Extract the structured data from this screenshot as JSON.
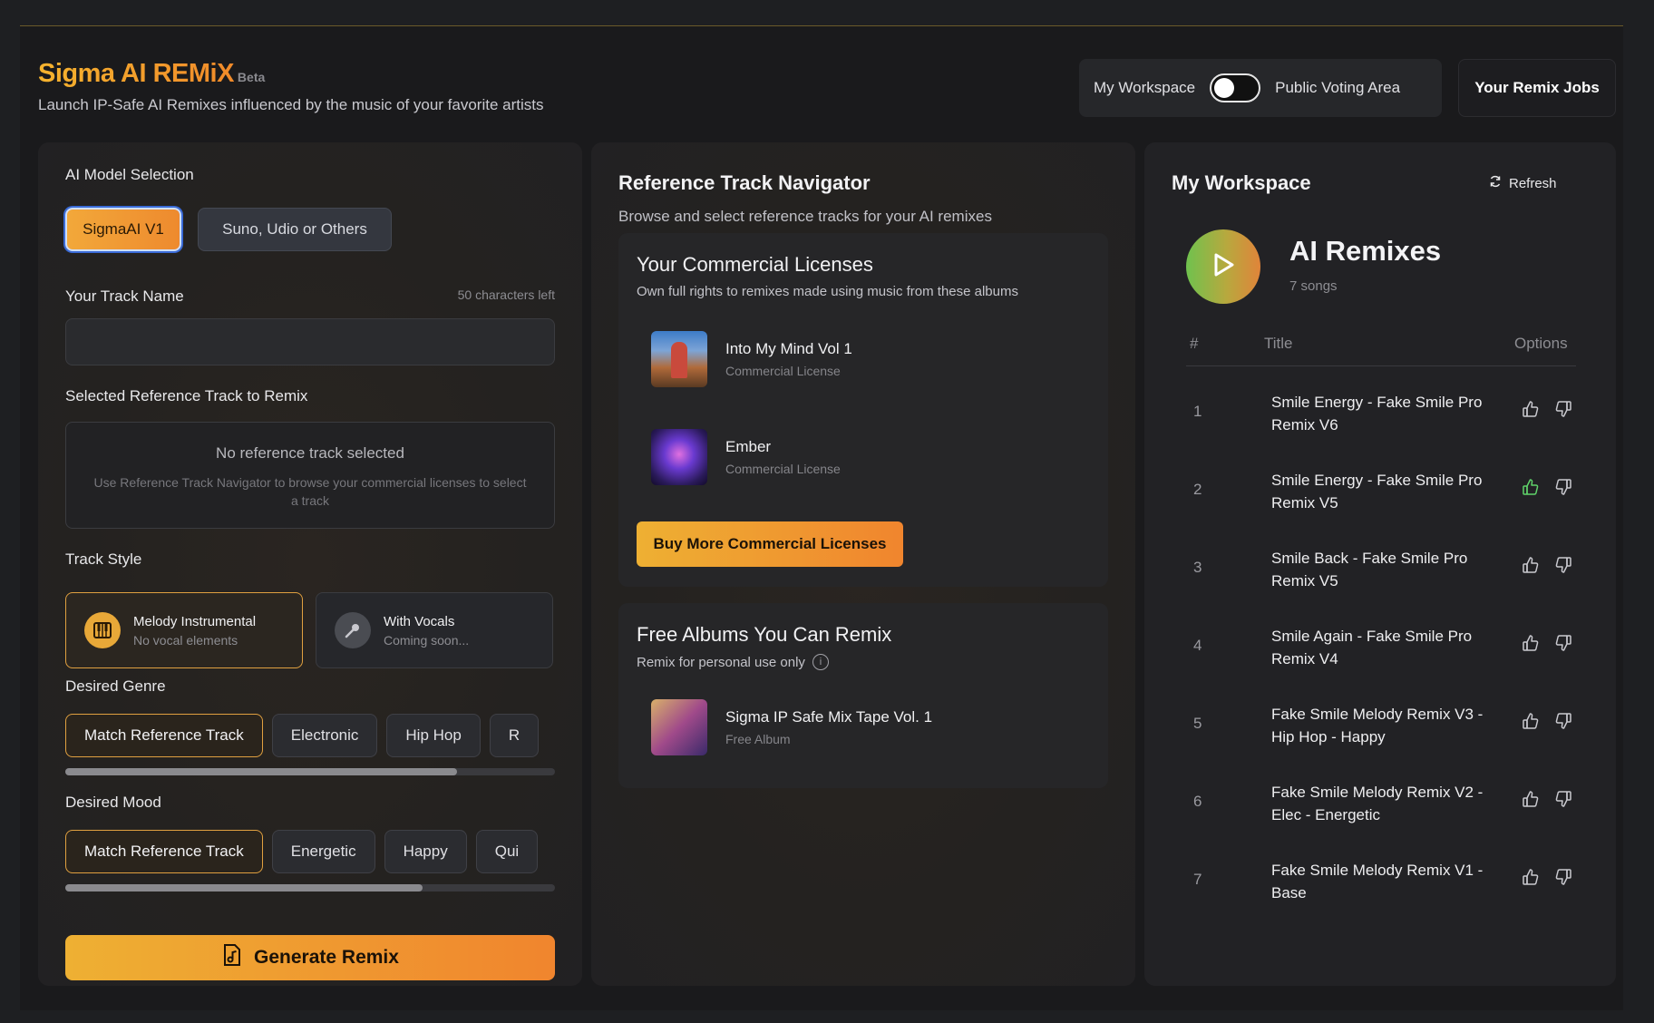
{
  "header": {
    "title": "Sigma AI REMiX",
    "beta": "Beta",
    "subtitle": "Launch IP-Safe AI Remixes influenced by the music of your favorite artists",
    "toggle_left": "My Workspace",
    "toggle_right": "Public Voting Area",
    "jobs_button": "Your Remix Jobs"
  },
  "left_panel": {
    "model_label": "AI Model Selection",
    "models": [
      "SigmaAI V1",
      "Suno, Udio or Others"
    ],
    "track_name_label": "Your Track Name",
    "chars_left": "50 characters left",
    "track_name_value": "",
    "ref_label": "Selected Reference Track to Remix",
    "ref_empty_title": "No reference track selected",
    "ref_empty_desc": "Use Reference Track Navigator to browse your commercial licenses to select a track",
    "style_label": "Track Style",
    "styles": [
      {
        "name": "Melody Instrumental",
        "desc": "No vocal elements",
        "icon": "piano-icon"
      },
      {
        "name": "With Vocals",
        "desc": "Coming soon...",
        "icon": "microphone-icon"
      }
    ],
    "genre_label": "Desired Genre",
    "genres": [
      "Match Reference Track",
      "Electronic",
      "Hip Hop",
      "R"
    ],
    "genre_scroll_fraction": 0.8,
    "mood_label": "Desired Mood",
    "moods": [
      "Match Reference Track",
      "Energetic",
      "Happy",
      "Qui"
    ],
    "mood_scroll_fraction": 0.73,
    "generate_button": "Generate Remix"
  },
  "navigator": {
    "title": "Reference Track Navigator",
    "subtitle": "Browse and select reference tracks for your AI remixes",
    "commercial": {
      "title": "Your Commercial Licenses",
      "desc": "Own full rights to remixes made using music from these albums",
      "albums": [
        {
          "name": "Into My Mind Vol 1",
          "license": "Commercial License"
        },
        {
          "name": "Ember",
          "license": "Commercial License"
        }
      ],
      "buy_button": "Buy More Commercial Licenses"
    },
    "free": {
      "title": "Free Albums You Can Remix",
      "desc": "Remix for personal use only",
      "albums": [
        {
          "name": "Sigma IP Safe Mix Tape Vol. 1",
          "license": "Free Album"
        }
      ]
    }
  },
  "workspace": {
    "title": "My Workspace",
    "refresh": "Refresh",
    "playlist_title": "AI Remixes",
    "playlist_count": "7 songs",
    "col_num": "#",
    "col_title": "Title",
    "col_options": "Options",
    "tracks": [
      {
        "num": "1",
        "title": "Smile Energy - Fake Smile Pro Remix V6",
        "liked": false
      },
      {
        "num": "2",
        "title": "Smile Energy - Fake Smile Pro Remix V5",
        "liked": true
      },
      {
        "num": "3",
        "title": "Smile Back - Fake Smile Pro Remix V5",
        "liked": false
      },
      {
        "num": "4",
        "title": "Smile Again - Fake Smile Pro Remix V4",
        "liked": false
      },
      {
        "num": "5",
        "title": "Fake Smile Melody Remix V3 - Hip Hop - Happy",
        "liked": false
      },
      {
        "num": "6",
        "title": "Fake Smile Melody Remix V2 - Elec - Energetic",
        "liked": false
      },
      {
        "num": "7",
        "title": "Fake Smile Melody Remix V1 - Base",
        "liked": false
      }
    ]
  },
  "colors": {
    "accent": "#f0a030",
    "liked": "#5fd36a"
  }
}
